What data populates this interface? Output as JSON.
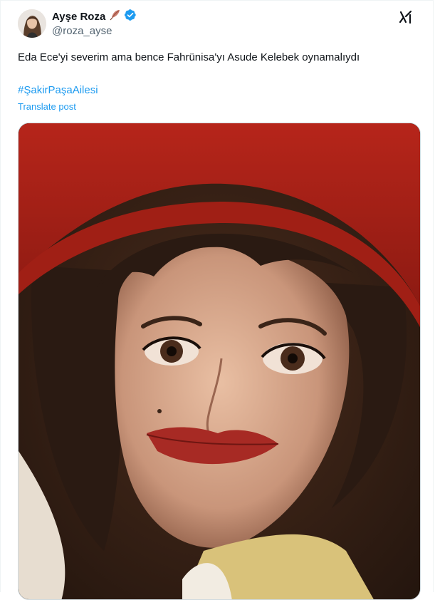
{
  "tweet": {
    "author": {
      "display_name": "Ayşe Roza",
      "handle": "@roza_ayse",
      "name_emoji": "feather-emoji",
      "verified_color": "#1d9bf0"
    },
    "text": "Eda Ece'yi severim ama bence Fahrünisa'yı Asude Kelebek oynamalıydı",
    "hashtag": "#ŞakirPaşaAilesi",
    "translate_label": "Translate post",
    "media_icon": "grok-icon"
  },
  "colors": {
    "link": "#1d9bf0",
    "text": "#0f1419",
    "secondary": "#536471"
  }
}
